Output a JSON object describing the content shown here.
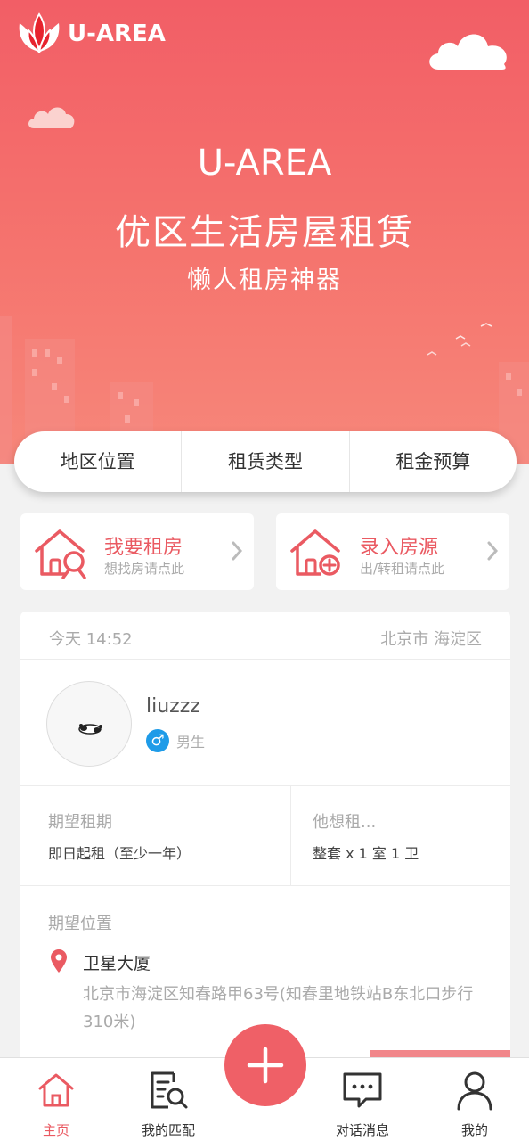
{
  "header": {
    "logo_text": "U-AREA",
    "brand_color": "#f25e66"
  },
  "hero": {
    "title": "U-AREA",
    "subtitle": "优区生活房屋租赁",
    "slogan": "懒人租房神器"
  },
  "filters": [
    {
      "label": "地区位置"
    },
    {
      "label": "租赁类型"
    },
    {
      "label": "租金预算"
    }
  ],
  "actions": [
    {
      "title": "我要租房",
      "subtitle": "想找房请点此",
      "icon": "house-search-icon"
    },
    {
      "title": "录入房源",
      "subtitle": "出/转租请点此",
      "icon": "house-add-icon"
    }
  ],
  "listing": {
    "time": "今天 14:52",
    "location": "北京市 海淀区",
    "user": {
      "name": "liuzzz",
      "gender": "男生",
      "gender_symbol": "♂"
    },
    "expected_period_label": "期望租期",
    "expected_period_value": "即日起租（至少一年）",
    "wants_label": "他想租...",
    "wants_value": "整套 x 1 室 1 卫",
    "expected_location_label": "期望位置",
    "place_name": "卫星大厦",
    "place_address": "北京市海淀区知春路甲63号(知春里地铁站B东北口步行310米)"
  },
  "tabbar": {
    "items": [
      {
        "label": "主页",
        "icon": "home-icon",
        "active": true
      },
      {
        "label": "我的匹配",
        "icon": "match-search-icon"
      },
      {
        "label": "对话消息",
        "icon": "chat-icon"
      },
      {
        "label": "我的",
        "icon": "user-icon"
      }
    ],
    "fab_icon": "plus-icon"
  }
}
